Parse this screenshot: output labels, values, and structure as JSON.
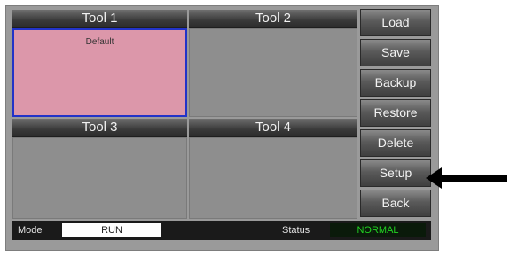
{
  "tool_slots": [
    {
      "title": "Tool 1",
      "preset": "Default",
      "selected": true
    },
    {
      "title": "Tool 2",
      "preset": "",
      "selected": false
    },
    {
      "title": "Tool 3",
      "preset": "",
      "selected": false
    },
    {
      "title": "Tool 4",
      "preset": "",
      "selected": false
    }
  ],
  "side_buttons": {
    "load": "Load",
    "save": "Save",
    "backup": "Backup",
    "restore": "Restore",
    "delete": "Delete",
    "setup": "Setup",
    "back": "Back"
  },
  "status_bar": {
    "mode_label": "Mode",
    "mode_value": "RUN",
    "status_label": "Status",
    "status_value": "NORMAL"
  },
  "colors": {
    "selected_slot": "#dc97aa",
    "selected_border": "#2233c8",
    "status_ok": "#22d322"
  },
  "annotation": {
    "icon": "arrow-left-icon",
    "points_to": "Setup"
  }
}
